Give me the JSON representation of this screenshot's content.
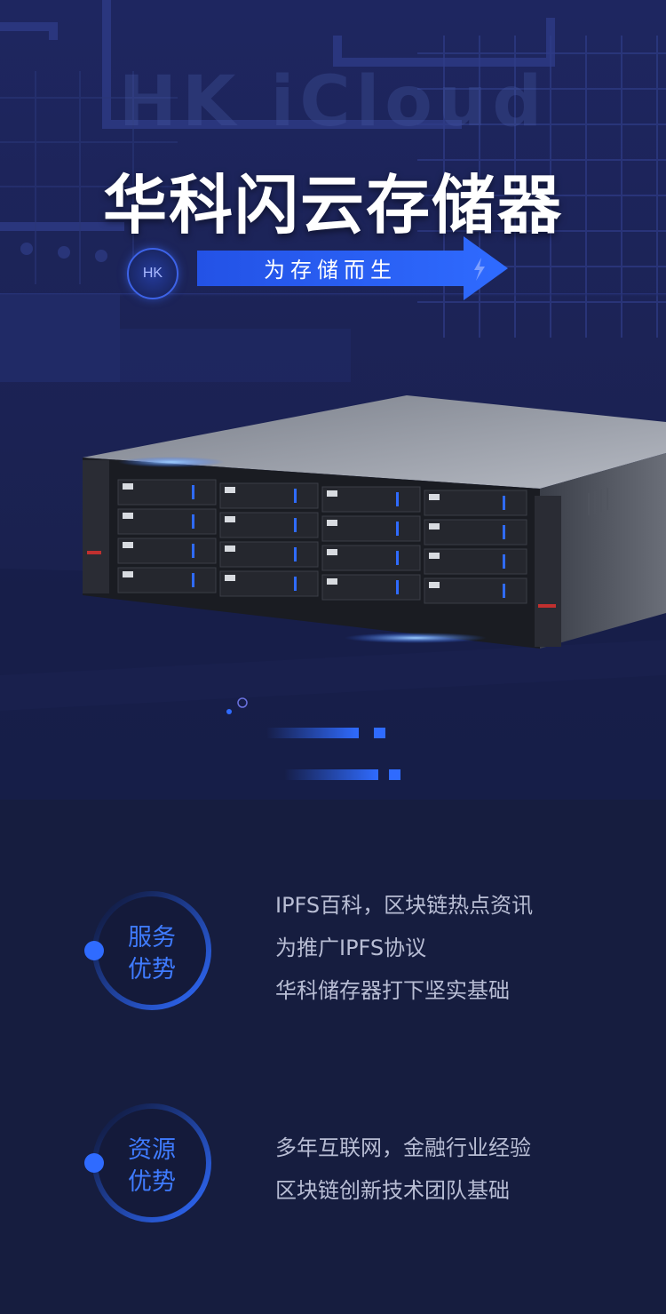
{
  "watermark": "HK iCloud",
  "title": "华科闪云存储器",
  "badge": "HK",
  "slogan": "为存储而生",
  "advantages": [
    {
      "label_line1": "服务",
      "label_line2": "优势",
      "lines": [
        "IPFS百科，区块链热点资讯",
        "为推广IPFS协议",
        "华科储存器打下坚实基础"
      ]
    },
    {
      "label_line1": "资源",
      "label_line2": "优势",
      "lines": [
        "多年互联网，金融行业经验",
        "区块链创新技术团队基础"
      ]
    }
  ],
  "colors": {
    "background": "#161d3f",
    "accent": "#2f6bff",
    "text": "#b8bdd4",
    "title": "#ffffff"
  },
  "icons": {
    "bolt": "lightning-icon",
    "arrow": "arrow-right-icon"
  }
}
